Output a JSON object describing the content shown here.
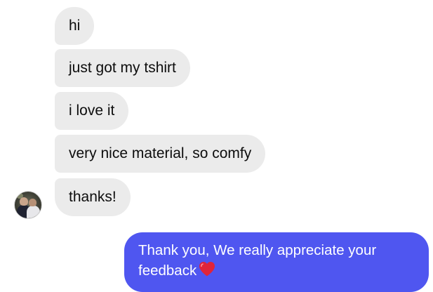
{
  "conversation": {
    "incoming": [
      {
        "text": "hi"
      },
      {
        "text": "just got my tshirt"
      },
      {
        "text": "i love it"
      },
      {
        "text": "very nice material, so comfy"
      },
      {
        "text": "thanks!"
      }
    ],
    "outgoing": [
      {
        "text": "Thank you, We really appreciate your feedback",
        "emoji": "red-heart-icon"
      }
    ]
  },
  "contact": {
    "avatar": "profile-photo"
  },
  "colors": {
    "incoming_bubble": "#ebebeb",
    "outgoing_bubble": "#4f56f0",
    "heart": "#e0243a"
  }
}
